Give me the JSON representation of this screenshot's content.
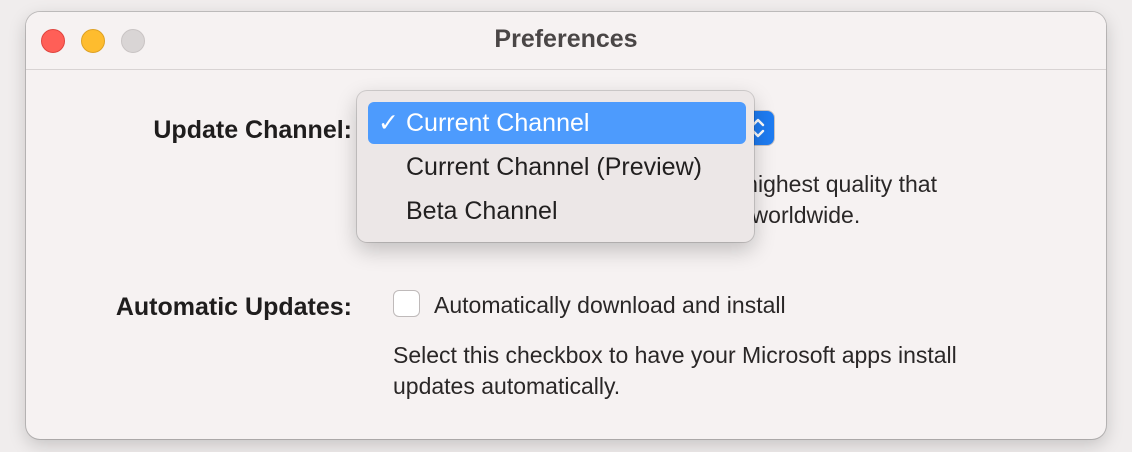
{
  "window": {
    "title": "Preferences"
  },
  "update_channel": {
    "label": "Update Channel:",
    "selected": "Current Channel",
    "options": [
      "Current Channel",
      "Current Channel (Preview)",
      "Beta Channel"
    ],
    "description_line1": "n highest quality that",
    "description_line2": "rs worldwide.",
    "checkmark": "✓"
  },
  "automatic_updates": {
    "label": "Automatic Updates:",
    "checkbox_label": "Automatically download and install",
    "checked": false,
    "description": "Select this checkbox to have your Microsoft apps install updates automatically."
  },
  "colors": {
    "accent": "#4d9bfd",
    "close": "#ff5f57",
    "minimize": "#febc2e",
    "zoom": "#d9d5d5"
  },
  "icons": [
    "close-button",
    "minimize-button",
    "zoom-button",
    "checkmark-icon",
    "chevron-updown-icon"
  ]
}
